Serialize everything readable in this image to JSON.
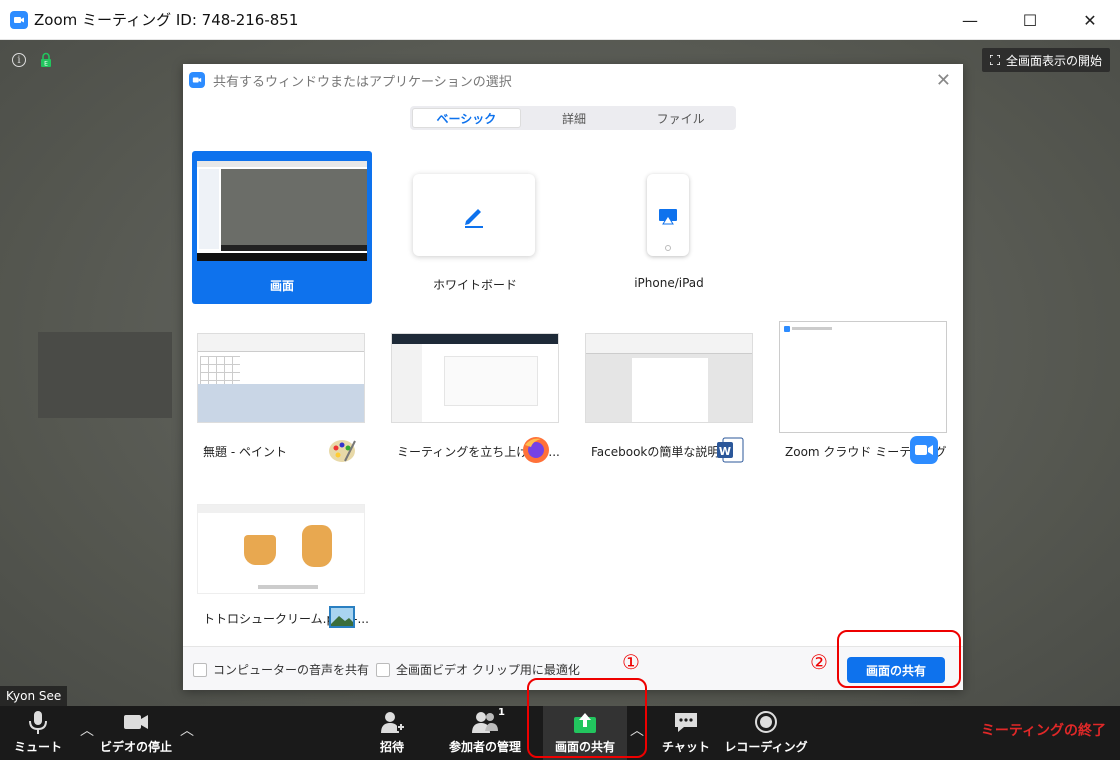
{
  "window": {
    "title": "Zoom ミーティング ID: 748-216-851",
    "min": "—",
    "max": "☐",
    "close": "✕"
  },
  "meeting": {
    "fullscreen_label": "全画面表示の開始",
    "participant_name": "Kyon See"
  },
  "dialog": {
    "title": "共有するウィンドウまたはアプリケーションの選択",
    "tabs": [
      "ベーシック",
      "詳細",
      "ファイル"
    ],
    "active_tab": "ベーシック",
    "tiles": [
      {
        "label": "画面",
        "selected": true
      },
      {
        "label": "ホワイトボード"
      },
      {
        "label": "iPhone/iPad"
      },
      {
        "label": "無題 - ペイント",
        "icon": "paint-icon"
      },
      {
        "label": "ミーティングを立ち上げる -...",
        "icon": "firefox-icon"
      },
      {
        "label": "Facebookの簡単な説明....",
        "icon": "word-icon"
      },
      {
        "label": "Zoom クラウド ミーティング",
        "icon": "zoom-icon"
      },
      {
        "label": "トトロシュークリーム.png -...",
        "icon": "photos-icon"
      }
    ],
    "checkbox_audio": "コンピューターの音声を共有",
    "checkbox_video": "全画面ビデオ クリップ用に最適化",
    "share_button": "画面の共有"
  },
  "annotations": {
    "one": "①",
    "two": "②"
  },
  "toolbar": {
    "mute": "ミュート",
    "video": "ビデオの停止",
    "invite": "招待",
    "participants": "参加者の管理",
    "participants_count": "1",
    "share": "画面の共有",
    "chat": "チャット",
    "record": "レコーディング",
    "end": "ミーティングの終了"
  },
  "colors": {
    "accent": "#0e72ed",
    "share_green": "#22c55e",
    "end_red": "#e02828",
    "annotation_red": "#e00000"
  }
}
